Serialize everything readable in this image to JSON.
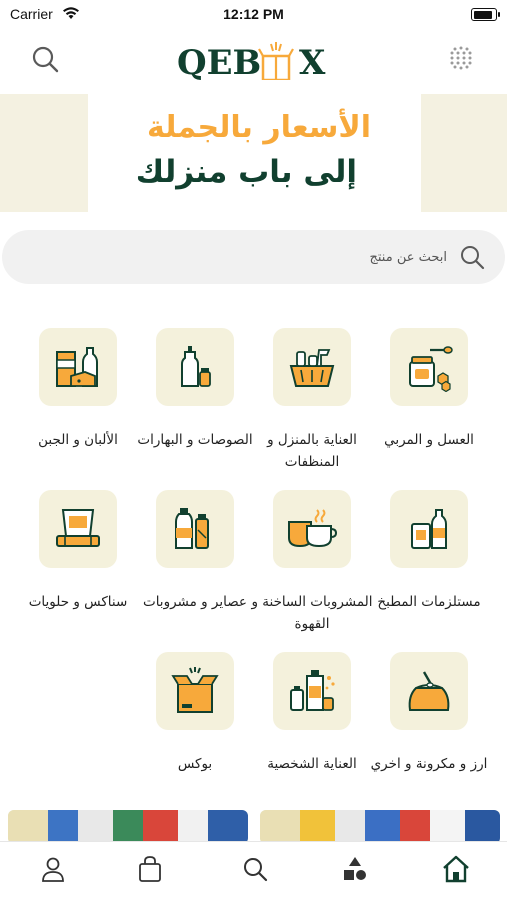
{
  "status_bar": {
    "carrier": "Carrier",
    "time": "12:12 PM",
    "battery_level": 0.9
  },
  "header": {
    "logo_text": "QEB  X"
  },
  "banner": {
    "line1": "الأسعار بالجملة",
    "line2": "إلى باب منزلك"
  },
  "search": {
    "placeholder": "ابحث عن منتج",
    "value": ""
  },
  "categories": [
    {
      "label": "العسل و المربي",
      "icon": "honey-jar-icon"
    },
    {
      "label": "العناية بالمنزل و المنظفات",
      "icon": "cleaning-basket-icon"
    },
    {
      "label": "الصوصات و البهارات",
      "icon": "sauce-bottle-icon"
    },
    {
      "label": "الألبان و الجبن",
      "icon": "dairy-icon"
    },
    {
      "label": "مستلزمات المطبخ",
      "icon": "kitchen-supplies-icon"
    },
    {
      "label": "المشروبات الساخنة و القهوة",
      "icon": "coffee-cup-icon"
    },
    {
      "label": "عصاير و مشروبات",
      "icon": "juice-bottles-icon"
    },
    {
      "label": "سناكس و حلويات",
      "icon": "snacks-icon"
    },
    {
      "label": "ارز و مكرونة و اخري",
      "icon": "rice-sack-icon"
    },
    {
      "label": "العناية الشخصية",
      "icon": "personal-care-icon"
    },
    {
      "label": "بوكس",
      "icon": "box-icon"
    }
  ],
  "tabbar": {
    "items": [
      {
        "name": "profile",
        "icon": "user-icon"
      },
      {
        "name": "cart",
        "icon": "shopping-bag-icon"
      },
      {
        "name": "search",
        "icon": "search-icon"
      },
      {
        "name": "categories",
        "icon": "shapes-icon"
      },
      {
        "name": "home",
        "icon": "home-icon",
        "active": true
      }
    ]
  },
  "colors": {
    "brand_green": "#11402f",
    "accent_orange": "#f7a93b",
    "tile_bg": "#f4f1dc",
    "banner_bg": "#f4f1e1"
  }
}
